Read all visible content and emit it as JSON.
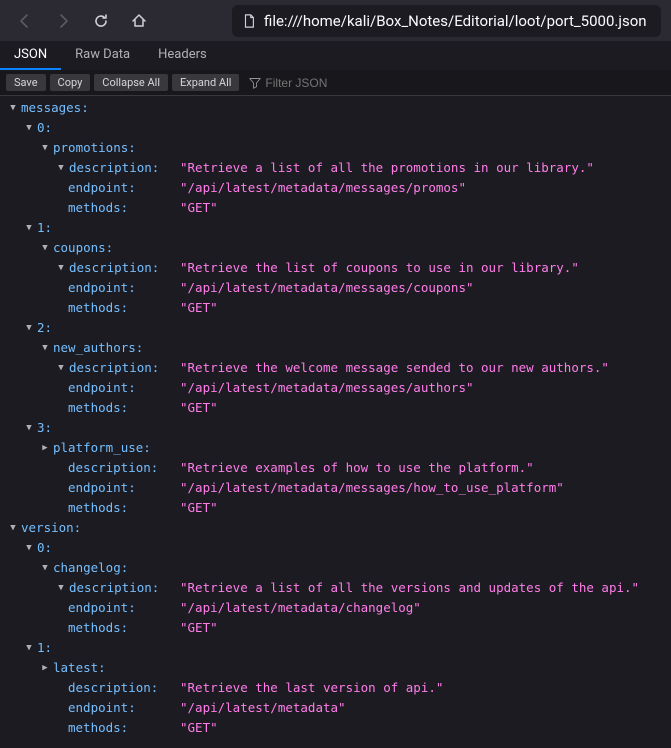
{
  "browser": {
    "url": "file:///home/kali/Box_Notes/Editorial/loot/port_5000.json"
  },
  "tabs": {
    "json": "JSON",
    "raw": "Raw Data",
    "headers": "Headers"
  },
  "toolbar": {
    "save": "Save",
    "copy": "Copy",
    "collapse": "Collapse All",
    "expand": "Expand All",
    "filter_placeholder": "Filter JSON"
  },
  "tree": {
    "messages_key": "messages:",
    "version_key": "version:",
    "idx0": "0:",
    "idx1": "1:",
    "idx2": "2:",
    "idx3": "3:",
    "promotions_key": "promotions:",
    "coupons_key": "coupons:",
    "new_authors_key": "new_authors:",
    "platform_use_key": "platform_use:",
    "changelog_key": "changelog:",
    "latest_key": "latest:",
    "description_key": "description:",
    "endpoint_key": "endpoint:",
    "methods_key": "methods:",
    "promotions": {
      "description": "\"Retrieve a list of all the promotions in our library.\"",
      "endpoint": "\"/api/latest/metadata/messages/promos\"",
      "methods": "\"GET\""
    },
    "coupons": {
      "description": "\"Retrieve the list of coupons to use in our library.\"",
      "endpoint": "\"/api/latest/metadata/messages/coupons\"",
      "methods": "\"GET\""
    },
    "new_authors": {
      "description": "\"Retrieve the welcome message sended to our new authors.\"",
      "endpoint": "\"/api/latest/metadata/messages/authors\"",
      "methods": "\"GET\""
    },
    "platform_use": {
      "description": "\"Retrieve examples of how to use the platform.\"",
      "endpoint": "\"/api/latest/metadata/messages/how_to_use_platform\"",
      "methods": "\"GET\""
    },
    "changelog": {
      "description": "\"Retrieve a list of all the versions and updates of the api.\"",
      "endpoint": "\"/api/latest/metadata/changelog\"",
      "methods": "\"GET\""
    },
    "latest": {
      "description": "\"Retrieve the last version of api.\"",
      "endpoint": "\"/api/latest/metadata\"",
      "methods": "\"GET\""
    }
  }
}
